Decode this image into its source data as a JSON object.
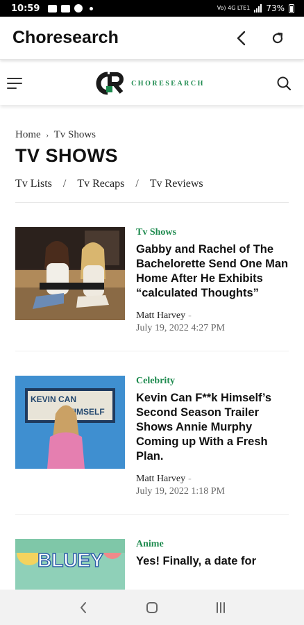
{
  "status_bar": {
    "time": "10:59",
    "network": "Vo) 4G LTE1",
    "battery": "73%"
  },
  "app_bar": {
    "title": "Choresearch",
    "back_icon": "chevron-left-icon",
    "refresh_icon": "refresh-icon"
  },
  "site_header": {
    "logo_text": "CHORESEARCH",
    "menu_icon": "hamburger-icon",
    "search_icon": "search-icon"
  },
  "breadcrumb": {
    "home": "Home",
    "separator": "›",
    "current": "Tv Shows"
  },
  "page_title": "TV SHOWS",
  "tabs": [
    {
      "label": "Tv Lists"
    },
    {
      "label": "Tv Recaps"
    },
    {
      "label": "Tv Reviews"
    }
  ],
  "tab_separator": "/",
  "articles": [
    {
      "category": "Tv Shows",
      "headline": "Gabby and Rachel of The Bachelorette Send One Man Home After He Exhibits “calculated Thoughts”",
      "author": "Matt Harvey",
      "dash": "-",
      "date": "July 19, 2022 4:27 PM"
    },
    {
      "category": "Celebrity",
      "headline": "Kevin Can F**k Himself’s Second Season Trailer Shows Annie Murphy Coming up With a Fresh Plan.",
      "author": "Matt Harvey",
      "dash": "-",
      "date": "July 19, 2022 1:18 PM",
      "thumb_sign_text_1": "KEVIN CAN",
      "thumb_sign_text_2": "HIMSELF"
    },
    {
      "category": "Anime",
      "headline": "Yes! Finally, a date for",
      "thumb_text": "BLUEY"
    }
  ],
  "colors": {
    "accent_green": "#1d8a4e",
    "logo_dark": "#1a1a1a"
  }
}
